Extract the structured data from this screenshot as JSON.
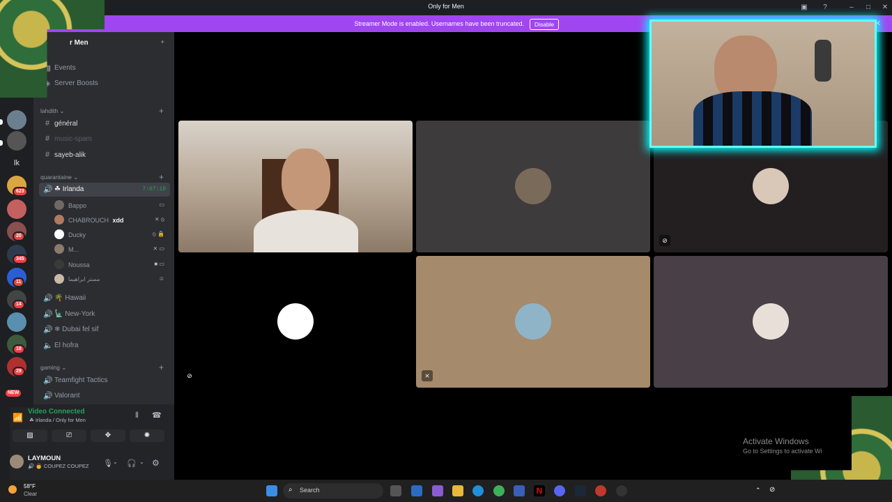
{
  "window": {
    "title": "Only for Men"
  },
  "banner": {
    "message": "Streamer Mode is enabled. Usernames have been truncated.",
    "disable_label": "Disable"
  },
  "server": {
    "name": "r Men"
  },
  "menu": [
    {
      "label": "Events",
      "icon": "calendar-icon"
    },
    {
      "label": "Server Boosts",
      "icon": "boost-icon"
    }
  ],
  "categories": [
    {
      "name": "lahdith",
      "channels": [
        "général",
        "music-spam",
        "sayeb-alik"
      ]
    },
    {
      "name": "quarantaine"
    },
    {
      "name": "gaming",
      "channels": [
        "Teamfight Tactics",
        "Valorant"
      ]
    }
  ],
  "active_voice": {
    "name": "Irlanda",
    "timer": "7:07:18"
  },
  "voice_users": [
    {
      "name": "Bappo",
      "color": "#6f6a66",
      "status": "screen-icon"
    },
    {
      "name": "CHABROUCH",
      "tag": "xdd",
      "color": "#b07a61",
      "status": "mute-icon"
    },
    {
      "name": "Ducky",
      "color": "#ffffff",
      "status": "lock-icon"
    },
    {
      "name": "M...",
      "color": "#8a7b6e",
      "status": "mute-icon"
    },
    {
      "name": "Noussa",
      "color": "#3a3a3a",
      "status": "camera-icon"
    },
    {
      "name": "مستر ابراهيما",
      "color": "#c9b9a6",
      "status": "emoji-icon"
    }
  ],
  "voice_channels": [
    "Hawaii",
    "New-York",
    "Dubai fel sif",
    "El hofra"
  ],
  "connection": {
    "status": "Video Connected",
    "location": "Irlanda / Only for Men"
  },
  "self": {
    "name": "LAYMOUN",
    "status": "COUPEZ COUPEZ"
  },
  "servers": [
    {
      "badge": ""
    },
    {
      "badge": ""
    },
    {
      "badge": "lk"
    },
    {
      "badge": "623"
    },
    {
      "badge": "20"
    },
    {
      "badge": "345"
    },
    {
      "badge": "11"
    },
    {
      "badge": "14"
    },
    {
      "badge": "18"
    },
    {
      "badge": "29"
    },
    {
      "badge": "NEW"
    }
  ],
  "tiles": [
    {
      "name": "camera-feed-1",
      "bg": "#c8c0b8",
      "type": "camera"
    },
    {
      "name": "user-tile-2",
      "bg": "#3e3b3c",
      "avatar_color": "#7a6a5a"
    },
    {
      "name": "user-tile-3",
      "bg": "#231f21",
      "avatar_color": "#d9c8b8"
    },
    {
      "name": "user-tile-4",
      "bg": "#000000",
      "avatar_color": "#ffffff"
    },
    {
      "name": "user-tile-5",
      "bg": "#a58a6c",
      "avatar_color": "#8fb4c8"
    },
    {
      "name": "user-tile-6",
      "bg": "#493f46",
      "avatar_color": "#e8e0d8"
    }
  ],
  "taskbar": {
    "weather_temp": "58°F",
    "weather_desc": "Clear",
    "search_placeholder": "Search"
  },
  "watermark": {
    "line1": "Activate Windows",
    "line2": "Go to Settings to activate Wi"
  }
}
